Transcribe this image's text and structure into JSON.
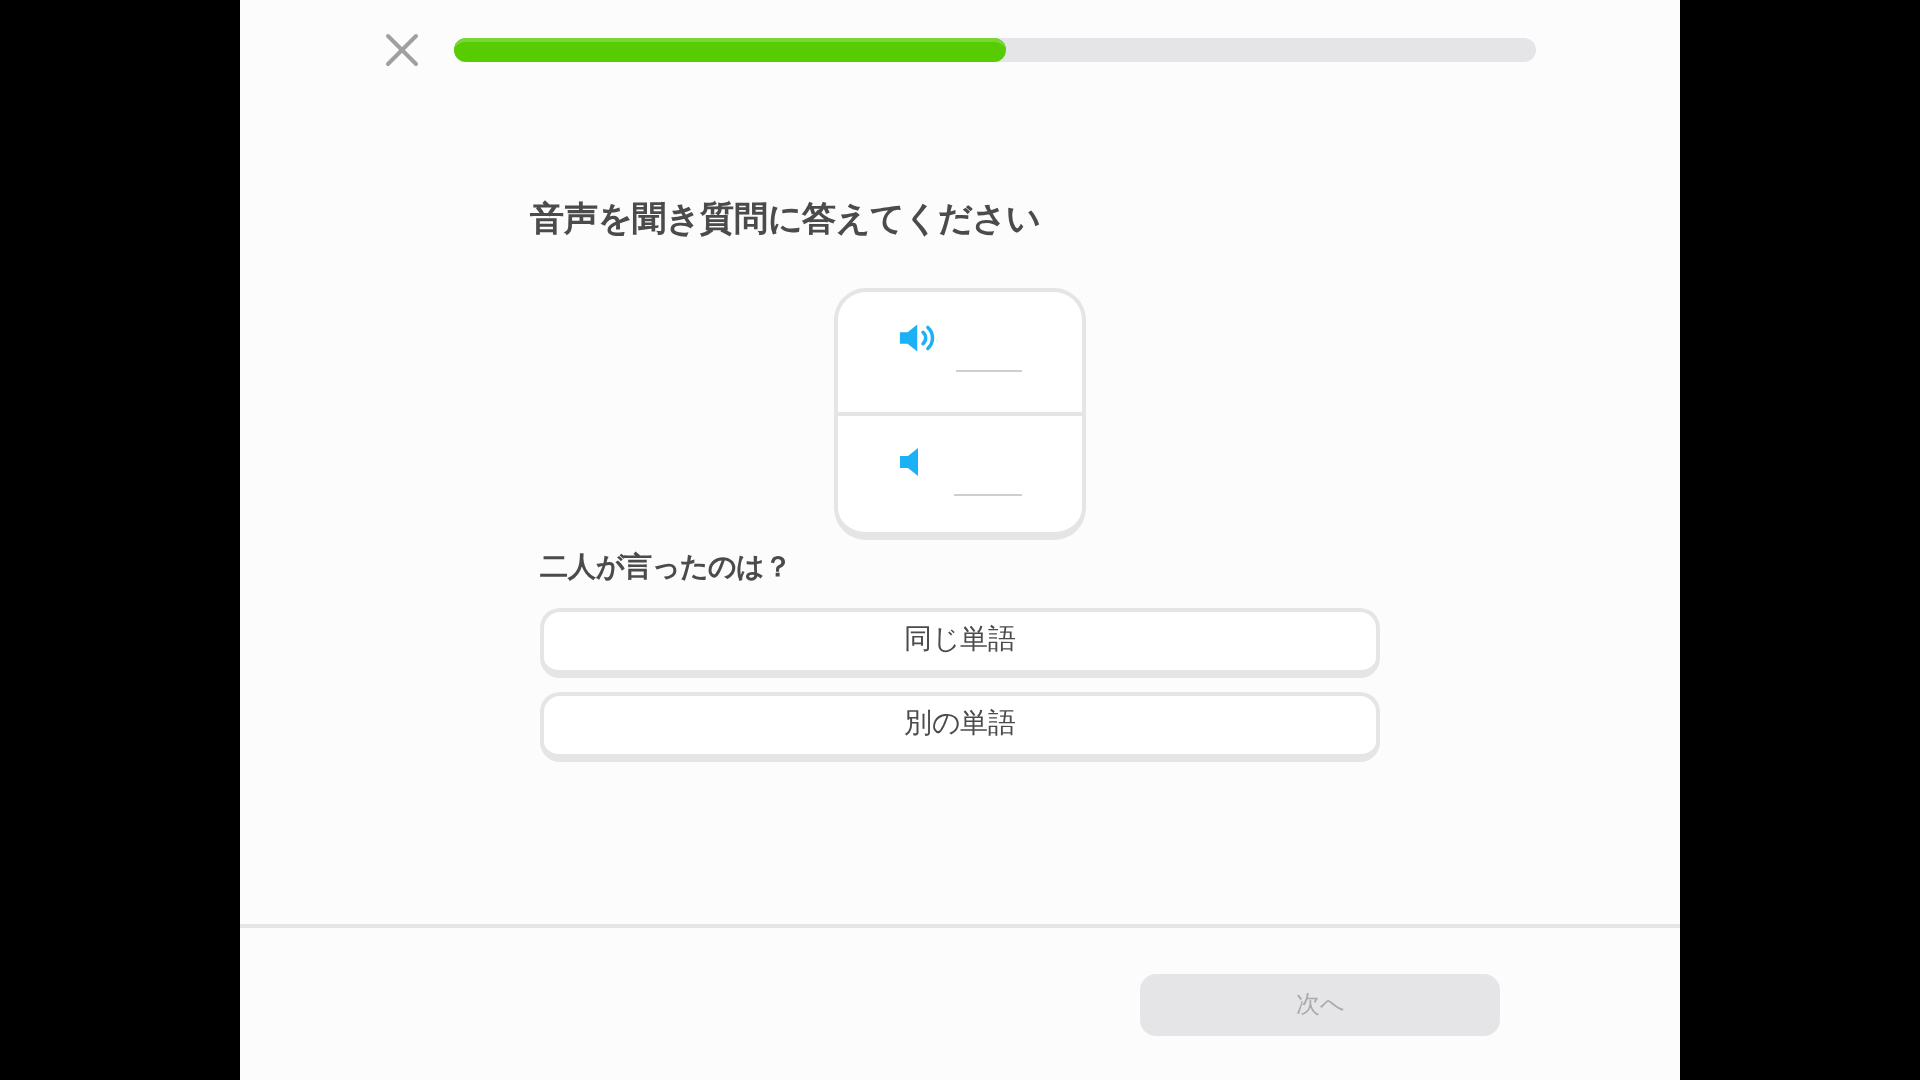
{
  "progress": {
    "level": 0.51
  },
  "instruction": "音声を聞き質問に答えてください",
  "audio_rows": [
    {
      "kind": "normal"
    },
    {
      "kind": "slow"
    }
  ],
  "question": "二人が言ったのは？",
  "options": [
    {
      "label": "同じ単語",
      "selected": false
    },
    {
      "label": "別の単語",
      "selected": false
    }
  ],
  "next_button": {
    "label": "次へ",
    "disabled": true
  }
}
